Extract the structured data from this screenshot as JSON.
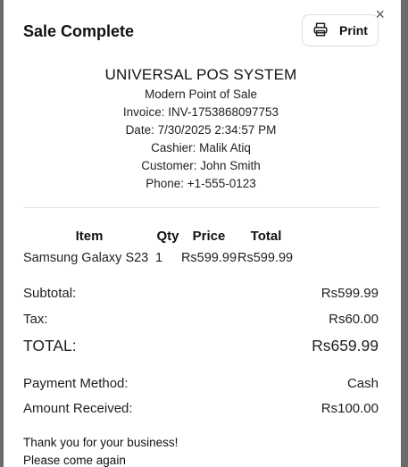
{
  "dialog": {
    "title": "Sale Complete",
    "print_label": "Print",
    "close_symbol": "×"
  },
  "receipt": {
    "store_name": "UNIVERSAL POS SYSTEM",
    "tagline": "Modern Point of Sale",
    "invoice": "Invoice: INV-1753868097753",
    "date": "Date: 7/30/2025 2:34:57 PM",
    "cashier": "Cashier: Malik Atiq",
    "customer": "Customer: John Smith",
    "phone": "Phone: +1-555-0123"
  },
  "items_table": {
    "headers": [
      "Item",
      "Qty",
      "Price",
      "Total"
    ],
    "rows": [
      {
        "item": "Samsung Galaxy S23",
        "qty": "1",
        "price": "Rs599.99",
        "total": "Rs599.99"
      }
    ]
  },
  "summary": {
    "subtotal_label": "Subtotal:",
    "subtotal_value": "Rs599.99",
    "tax_label": "Tax:",
    "tax_value": "Rs60.00",
    "total_label": "TOTAL:",
    "total_value": "Rs659.99",
    "payment_label": "Payment Method:",
    "payment_value": "Cash",
    "received_label": "Amount Received:",
    "received_value": "Rs100.00"
  },
  "footer": {
    "thanks": "Thank you for your business!",
    "come_again": "Please come again"
  },
  "icons": {
    "print": "printer-icon",
    "close": "close-icon"
  }
}
